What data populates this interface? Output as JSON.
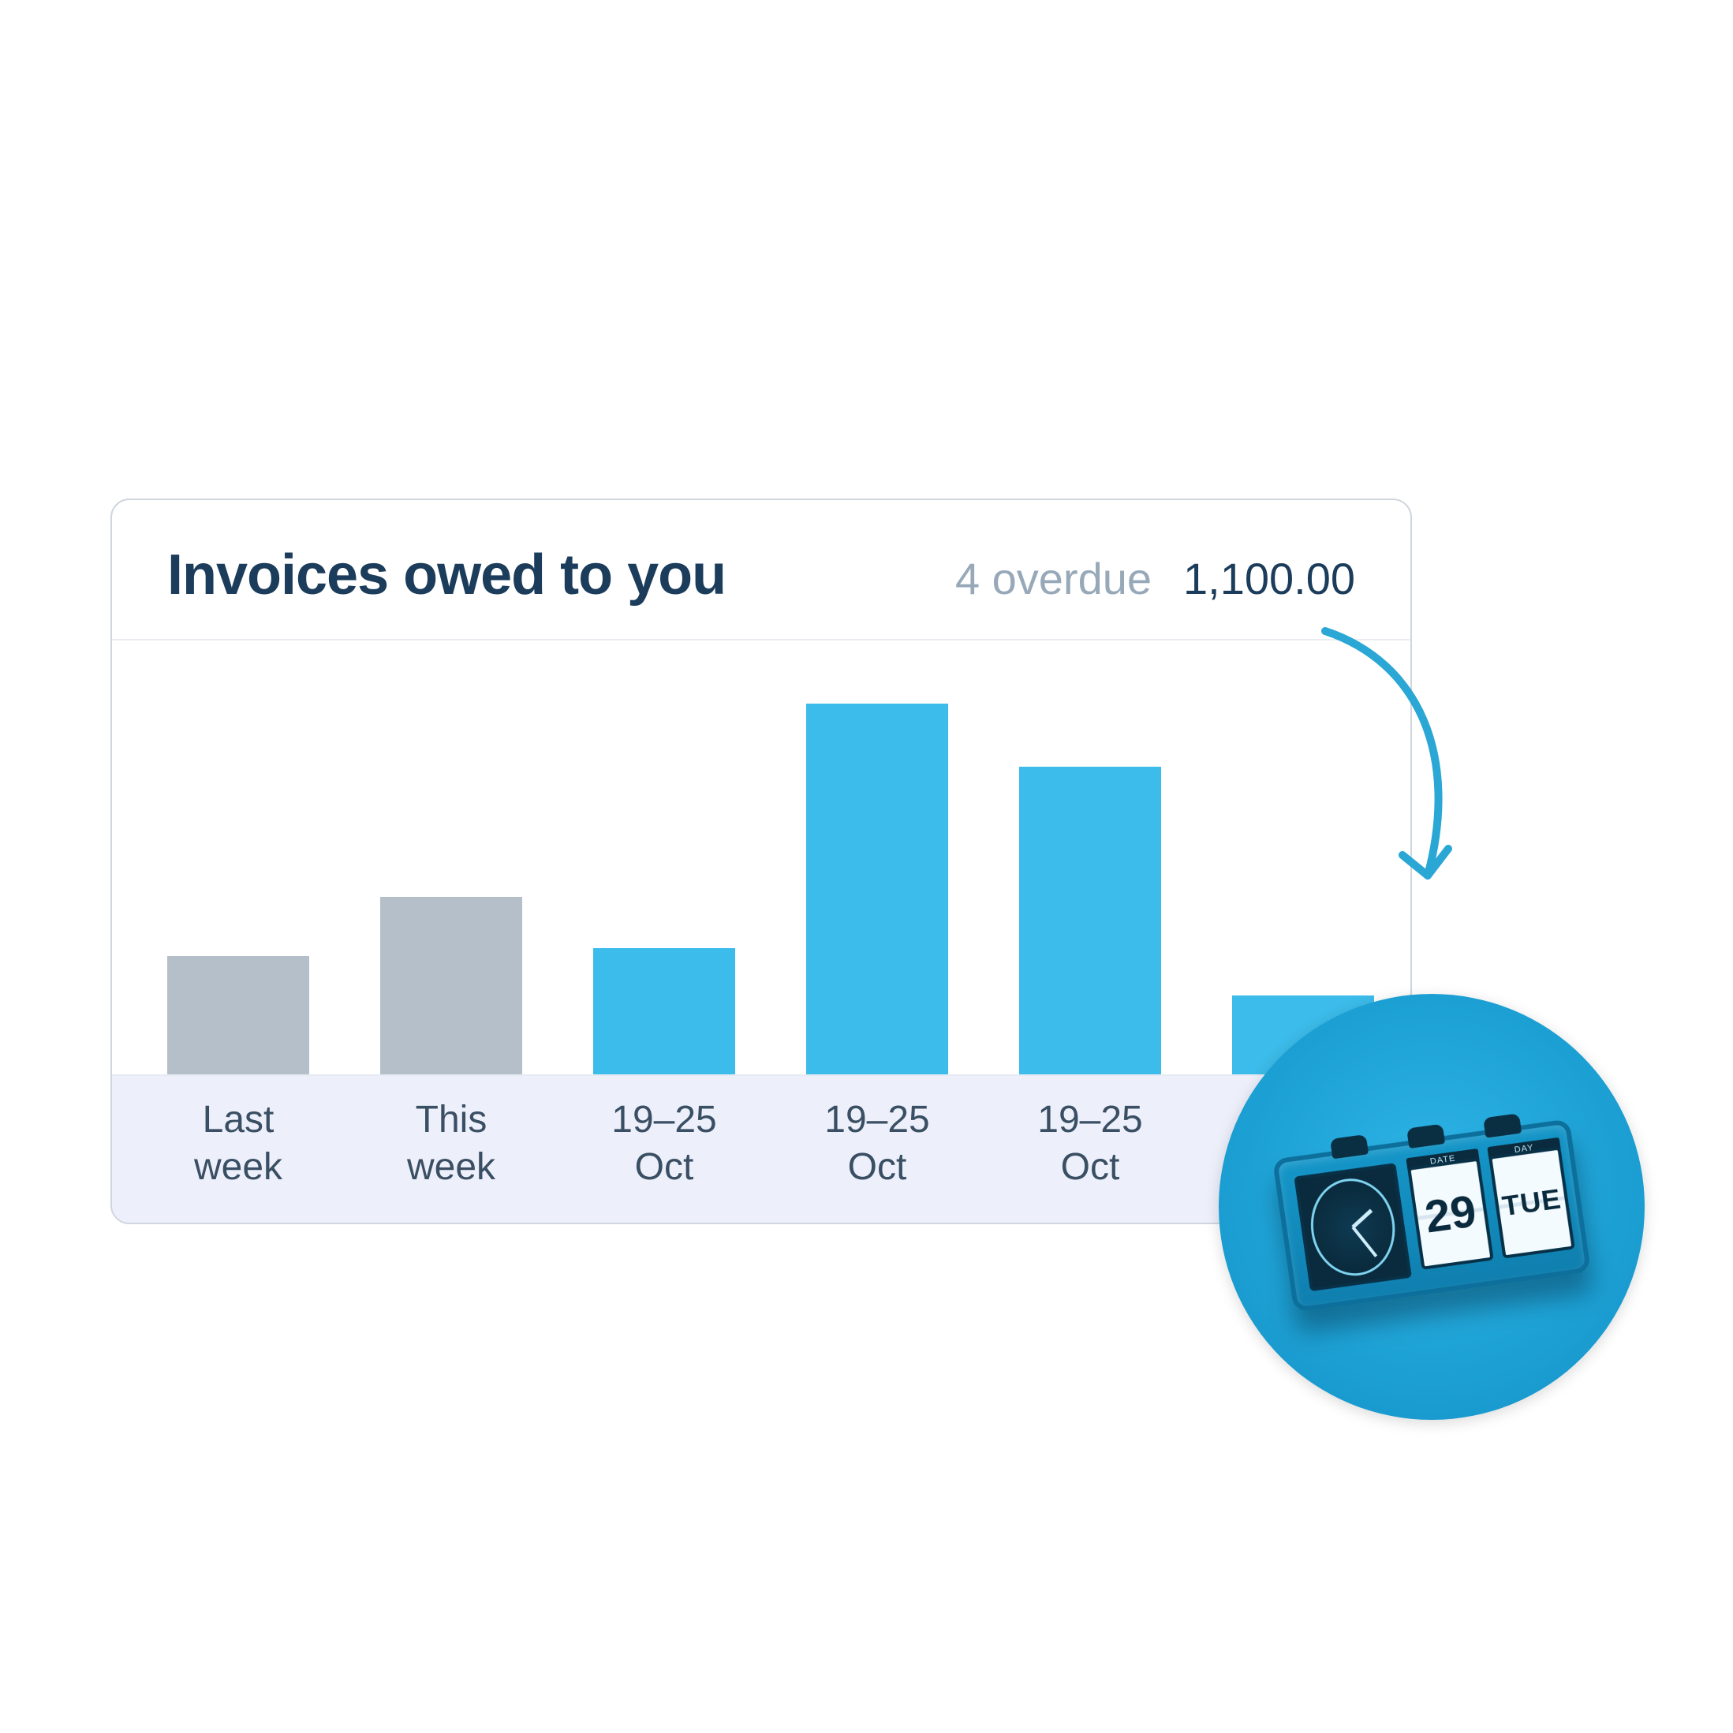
{
  "card": {
    "title": "Invoices owed to you",
    "overdue_label": "4 overdue",
    "overdue_amount": "1,100.00"
  },
  "chart_data": {
    "type": "bar",
    "title": "Invoices owed to you",
    "xlabel": "",
    "ylabel": "",
    "categories": [
      "Last week",
      "This week",
      "19–25 Oct",
      "19–25 Oct",
      "19–25 Oct",
      ""
    ],
    "values": [
      150,
      225,
      160,
      470,
      390,
      100
    ],
    "ylim": [
      0,
      500
    ],
    "bar_colors": [
      "grey",
      "grey",
      "blue",
      "blue",
      "blue",
      "blue"
    ]
  },
  "labels": [
    {
      "line1": "Last",
      "line2": "week"
    },
    {
      "line1": "This",
      "line2": "week"
    },
    {
      "line1": "19–25",
      "line2": "Oct"
    },
    {
      "line1": "19–25",
      "line2": "Oct"
    },
    {
      "line1": "19–25",
      "line2": "Oct"
    },
    {
      "line1": "",
      "line2": ""
    }
  ],
  "clock": {
    "date": "29",
    "day": "TUE",
    "cap_date": "DATE",
    "cap_day": "DAY"
  },
  "colors": {
    "grey_bar": "#b5bfc9",
    "blue_bar": "#3cbcea",
    "title": "#1b3c5a",
    "muted": "#97a8b9",
    "arrow": "#2aa7d4"
  }
}
